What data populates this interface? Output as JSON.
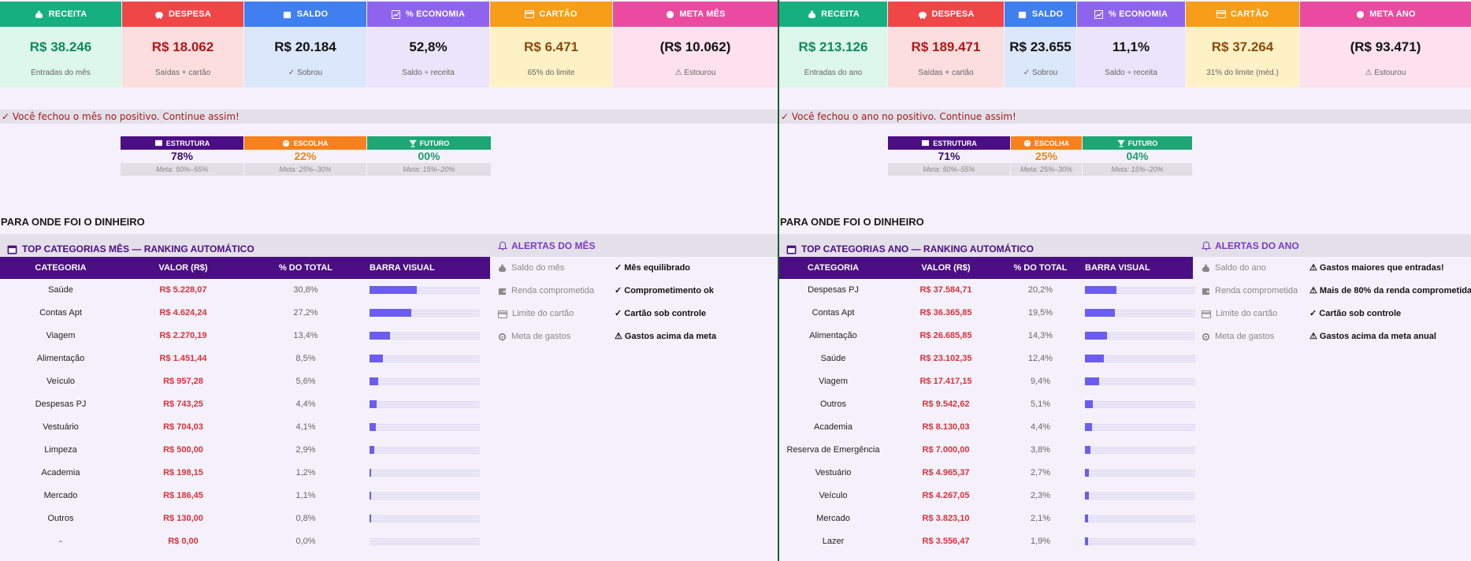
{
  "colors": {
    "receita": "#16b07f",
    "despesa": "#ef4747",
    "saldo": "#3f7ff0",
    "economia": "#8e64ef",
    "cartao": "#f89d18",
    "meta": "#ea4aa0",
    "estrutura": "#4b0e85",
    "escolha": "#f7811d",
    "futuro": "#1ea775",
    "bar_fill": "#6c5df0",
    "value_red": "#d9313b"
  },
  "left": {
    "cards": [
      {
        "icon": "money-bag-icon",
        "title": "RECEITA",
        "value": "R$ 38.246",
        "sub": "Entradas do mês"
      },
      {
        "icon": "piggy-bank-icon",
        "title": "DESPESA",
        "value": "R$ 18.062",
        "sub": "Saídas + cartão"
      },
      {
        "icon": "wallet-icon",
        "title": "SALDO",
        "value": "R$ 20.184",
        "sub": "✓ Sobrou"
      },
      {
        "icon": "chart-icon",
        "title": "% ECONOMIA",
        "value": "52,8%",
        "sub": "Saldo ÷ receita"
      },
      {
        "icon": "credit-card-icon",
        "title": "CARTÃO",
        "value": "R$ 6.471",
        "sub": "65% do limite"
      },
      {
        "icon": "target-icon",
        "title": "META MÊS",
        "value": "(R$ 10.062)",
        "sub": "⚠ Estourou"
      }
    ],
    "banner": "✓ Você fechou o mês no positivo. Continue assim!",
    "alloc": [
      {
        "label": "ESTRUTURA",
        "pct": "78%",
        "meta": "Meta: 50%–55%"
      },
      {
        "label": "ESCOLHA",
        "pct": "22%",
        "meta": "Meta: 25%–30%"
      },
      {
        "label": "FUTURO",
        "pct": "00%",
        "meta": "Meta: 15%–20%"
      }
    ],
    "section_title": "PARA ONDE FOI O DINHEIRO",
    "top_title": "TOP CATEGORIAS MÊS — RANKING AUTOMÁTICO",
    "headers": [
      "CATEGORIA",
      "VALOR (R$)",
      "% DO TOTAL",
      "BARRA VISUAL"
    ],
    "rows": [
      {
        "cat": "Saúde",
        "val": "R$ 5.228,07",
        "pct": "30,8%",
        "share": 0.308
      },
      {
        "cat": "Contas Apt",
        "val": "R$ 4.624,24",
        "pct": "27,2%",
        "share": 0.272
      },
      {
        "cat": "Viagem",
        "val": "R$ 2.270,19",
        "pct": "13,4%",
        "share": 0.134
      },
      {
        "cat": "Alimentação",
        "val": "R$ 1.451,44",
        "pct": "8,5%",
        "share": 0.085
      },
      {
        "cat": "Veículo",
        "val": "R$ 957,28",
        "pct": "5,6%",
        "share": 0.056
      },
      {
        "cat": "Despesas PJ",
        "val": "R$ 743,25",
        "pct": "4,4%",
        "share": 0.044
      },
      {
        "cat": "Vestuário",
        "val": "R$ 704,03",
        "pct": "4,1%",
        "share": 0.041
      },
      {
        "cat": "Limpeza",
        "val": "R$ 500,00",
        "pct": "2,9%",
        "share": 0.029
      },
      {
        "cat": "Academia",
        "val": "R$ 198,15",
        "pct": "1,2%",
        "share": 0.012
      },
      {
        "cat": "Mercado",
        "val": "R$ 186,45",
        "pct": "1,1%",
        "share": 0.011
      },
      {
        "cat": "Outros",
        "val": "R$ 130,00",
        "pct": "0,8%",
        "share": 0.008
      },
      {
        "cat": "-",
        "val": "R$ 0,00",
        "pct": "0,0%",
        "share": 0.0
      }
    ],
    "alerts_title": "ALERTAS DO MÊS",
    "alerts": [
      {
        "icon": "money-bag-icon",
        "label": "Saldo do mês",
        "status": "✓ Mês equilibrado"
      },
      {
        "icon": "wallet-icon",
        "label": "Renda comprometida",
        "status": "✓ Comprometimento ok"
      },
      {
        "icon": "credit-card-icon",
        "label": "Limite do cartão",
        "status": "✓ Cartão sob controle"
      },
      {
        "icon": "target-icon",
        "label": "Meta de gastos",
        "status": "⚠ Gastos acima da meta"
      }
    ]
  },
  "right": {
    "cards": [
      {
        "icon": "money-bag-icon",
        "title": "RECEITA",
        "value": "R$ 213.126",
        "sub": "Entradas do ano"
      },
      {
        "icon": "piggy-bank-icon",
        "title": "DESPESA",
        "value": "R$ 189.471",
        "sub": "Saídas + cartão"
      },
      {
        "icon": "wallet-icon",
        "title": "SALDO",
        "value": "R$ 23.655",
        "sub": "✓ Sobrou"
      },
      {
        "icon": "chart-icon",
        "title": "% ECONOMIA",
        "value": "11,1%",
        "sub": "Saldo ÷ receita"
      },
      {
        "icon": "credit-card-icon",
        "title": "CARTÃO",
        "value": "R$ 37.264",
        "sub": "31% do limite (méd.)"
      },
      {
        "icon": "target-icon",
        "title": "META ANO",
        "value": "(R$ 93.471)",
        "sub": "⚠ Estourou"
      }
    ],
    "banner": "✓ Você fechou o ano no positivo. Continue assim!",
    "alloc": [
      {
        "label": "ESTRUTURA",
        "pct": "71%",
        "meta": "Meta: 50%–55%"
      },
      {
        "label": "ESCOLHA",
        "pct": "25%",
        "meta": "Meta: 25%–30%"
      },
      {
        "label": "FUTURO",
        "pct": "04%",
        "meta": "Meta: 15%–20%"
      }
    ],
    "section_title": "PARA ONDE FOI O DINHEIRO",
    "top_title": "TOP CATEGORIAS ANO — RANKING AUTOMÁTICO",
    "headers": [
      "CATEGORIA",
      "VALOR (R$)",
      "% DO TOTAL",
      "BARRA VISUAL"
    ],
    "rows": [
      {
        "cat": "Despesas PJ",
        "val": "R$ 37.584,71",
        "pct": "20,2%",
        "share": 0.202
      },
      {
        "cat": "Contas Apt",
        "val": "R$ 36.365,85",
        "pct": "19,5%",
        "share": 0.195
      },
      {
        "cat": "Alimentação",
        "val": "R$ 26.685,85",
        "pct": "14,3%",
        "share": 0.143
      },
      {
        "cat": "Saúde",
        "val": "R$ 23.102,35",
        "pct": "12,4%",
        "share": 0.124
      },
      {
        "cat": "Viagem",
        "val": "R$ 17.417,15",
        "pct": "9,4%",
        "share": 0.094
      },
      {
        "cat": "Outros",
        "val": "R$ 9.542,62",
        "pct": "5,1%",
        "share": 0.051
      },
      {
        "cat": "Academia",
        "val": "R$ 8.130,03",
        "pct": "4,4%",
        "share": 0.044
      },
      {
        "cat": "Reserva de Emergência",
        "val": "R$ 7.000,00",
        "pct": "3,8%",
        "share": 0.038
      },
      {
        "cat": "Vestuário",
        "val": "R$ 4.965,37",
        "pct": "2,7%",
        "share": 0.027
      },
      {
        "cat": "Veículo",
        "val": "R$ 4.267,05",
        "pct": "2,3%",
        "share": 0.023
      },
      {
        "cat": "Mercado",
        "val": "R$ 3.823,10",
        "pct": "2,1%",
        "share": 0.021
      },
      {
        "cat": "Lazer",
        "val": "R$ 3.556,47",
        "pct": "1,9%",
        "share": 0.019
      }
    ],
    "alerts_title": "ALERTAS DO ANO",
    "alerts": [
      {
        "icon": "money-bag-icon",
        "label": "Saldo do ano",
        "status": "⚠ Gastos maiores que entradas!"
      },
      {
        "icon": "wallet-icon",
        "label": "Renda comprometida",
        "status": "⚠ Mais de 80% da renda comprometida"
      },
      {
        "icon": "credit-card-icon",
        "label": "Limite do cartão",
        "status": "✓ Cartão sob controle"
      },
      {
        "icon": "target-icon",
        "label": "Meta de gastos",
        "status": "⚠ Gastos acima da meta anual"
      }
    ]
  }
}
